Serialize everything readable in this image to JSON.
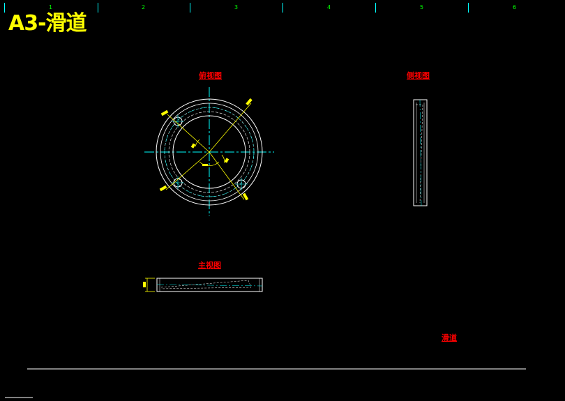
{
  "title": "A3-滑道",
  "zones": [
    "1",
    "2",
    "3",
    "4",
    "5",
    "6"
  ],
  "views": {
    "top": "俯视图",
    "side": "侧视图",
    "front": "主视图"
  },
  "part_name": "滑道",
  "colors": {
    "background": "#000000",
    "title": "#ffff00",
    "labels": "#ff0000",
    "zone_numbers": "#00ff00",
    "geometry": "#ffffff",
    "centerlines": "#00ffff",
    "dimensions": "#ffff00"
  }
}
